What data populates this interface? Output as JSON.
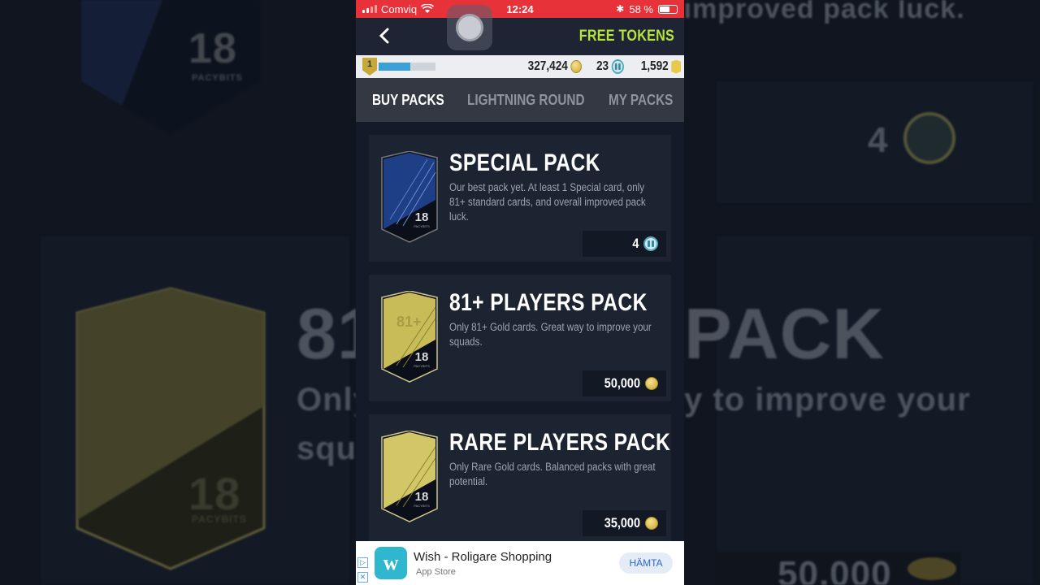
{
  "status_bar": {
    "carrier": "Comviq",
    "time": "12:24",
    "battery": "58 %"
  },
  "nav": {
    "back_icon": "chevron-left-icon",
    "free_tokens": "FREE TOKENS"
  },
  "currency": {
    "level": "1",
    "xp_progress": 0.55,
    "coins": "327,424",
    "tokens": "23",
    "points": "1,592"
  },
  "tabs": [
    {
      "label": "BUY PACKS",
      "active": true
    },
    {
      "label": "LIGHTNING ROUND",
      "active": false
    },
    {
      "label": "MY PACKS",
      "active": false
    }
  ],
  "packs": [
    {
      "title": "SPECIAL PACK",
      "description": "Our best pack yet. At least 1 Special card, only 81+ standard cards, and overall improved pack luck.",
      "price": "4",
      "currency_icon": "token-icon",
      "art_color": "#1e3f86",
      "pack_number": "18",
      "pack_brand": "PACYBITS"
    },
    {
      "title": "81+ PLAYERS PACK",
      "description": "Only 81+ Gold cards. Great way to improve your squads.",
      "price": "50,000",
      "currency_icon": "coin-icon",
      "art_color": "#c8bc58",
      "pack_number": "18",
      "pack_brand": "PACYBITS",
      "art_label": "81+"
    },
    {
      "title": "RARE PLAYERS PACK",
      "description": "Only Rare Gold cards. Balanced packs with great potential.",
      "price": "35,000",
      "currency_icon": "coin-icon",
      "art_color": "#c8bc58",
      "pack_number": "18",
      "pack_brand": "PACYBITS"
    }
  ],
  "ad": {
    "title": "Wish - Roligare Shopping",
    "store": "App Store",
    "button": "HÄMTA",
    "icon_letter": "w"
  },
  "background": {
    "top_text": "standard cards, and overall improved pack luck.",
    "number": "4",
    "big_left": "81",
    "big_right": "PACK",
    "sub_left": "Only",
    "sub_right": "y to improve your",
    "sub_left2": "squa",
    "bottom_right": "50,000",
    "card_number": "18",
    "card_brand": "PACYBITS"
  }
}
